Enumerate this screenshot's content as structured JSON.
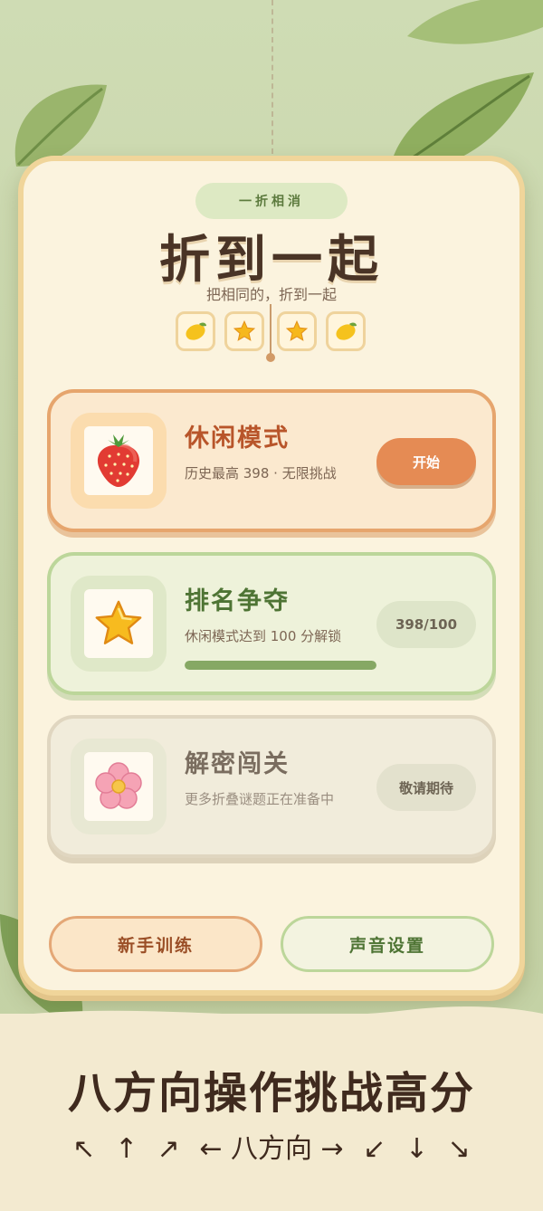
{
  "header": {
    "tag": "一折相消",
    "title": "折到一起",
    "subtitle": "把相同的，折到一起"
  },
  "tiles": [
    "lemon-icon",
    "star-icon",
    "star-icon",
    "lemon-icon"
  ],
  "modes": [
    {
      "name": "休闲模式",
      "icon": "strawberry-icon",
      "desc": "历史最高 398 · 无限挑战",
      "action": "开始"
    },
    {
      "name": "排名争夺",
      "icon": "star-icon",
      "desc": "休闲模式达到 100 分解锁",
      "status": "398/100",
      "progress": 1.0
    },
    {
      "name": "解密闯关",
      "icon": "flower-icon",
      "desc": "更多折叠谜题正在准备中",
      "status": "敬请期待"
    }
  ],
  "buttons": {
    "tutorial": "新手训练",
    "sound": "声音设置"
  },
  "footer": {
    "slogan": "八方向操作挑战高分",
    "directions": {
      "up_left": "↖",
      "up": "↑",
      "up_right": "↗",
      "center": "← 八方向 →",
      "down_left": "↙",
      "down": "↓",
      "down_right": "↘"
    }
  },
  "colors": {
    "accent": "#e58b54",
    "green": "#86a864",
    "card_bg": "#fbf3de",
    "title": "#4a3426"
  }
}
